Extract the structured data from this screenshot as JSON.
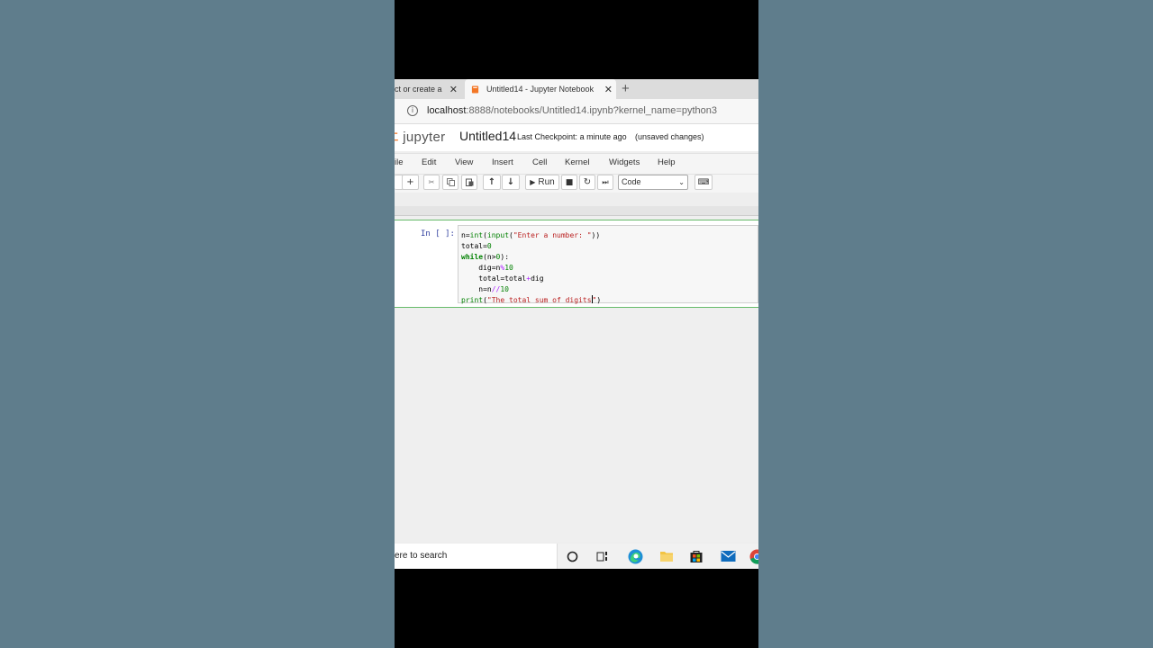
{
  "browser": {
    "tabs": [
      {
        "label": "ct or create a",
        "close": "✕"
      },
      {
        "label": "Untitled14 - Jupyter Notebook",
        "close": "✕"
      }
    ],
    "new_tab": "+",
    "url_host": "localhost",
    "url_rest": ":8888/notebooks/Untitled14.ipynb?kernel_name=python3"
  },
  "jupyter": {
    "logo_text": "jupyter",
    "notebook_name": "Untitled14",
    "checkpoint_label": "Last Checkpoint:",
    "checkpoint_time": "a minute ago",
    "unsaved": "(unsaved changes)"
  },
  "menu": [
    "ile",
    "Edit",
    "View",
    "Insert",
    "Cell",
    "Kernel",
    "Widgets",
    "Help"
  ],
  "toolbar": {
    "run_label": "Run",
    "cell_type": "Code"
  },
  "cell": {
    "prompt": "In [ ]:"
  },
  "taskbar": {
    "search_text": "ere to search"
  },
  "colors": {
    "background": "#5f7d8c",
    "cell_border": "#66bb6a",
    "jupyter_orange": "#f37726"
  }
}
